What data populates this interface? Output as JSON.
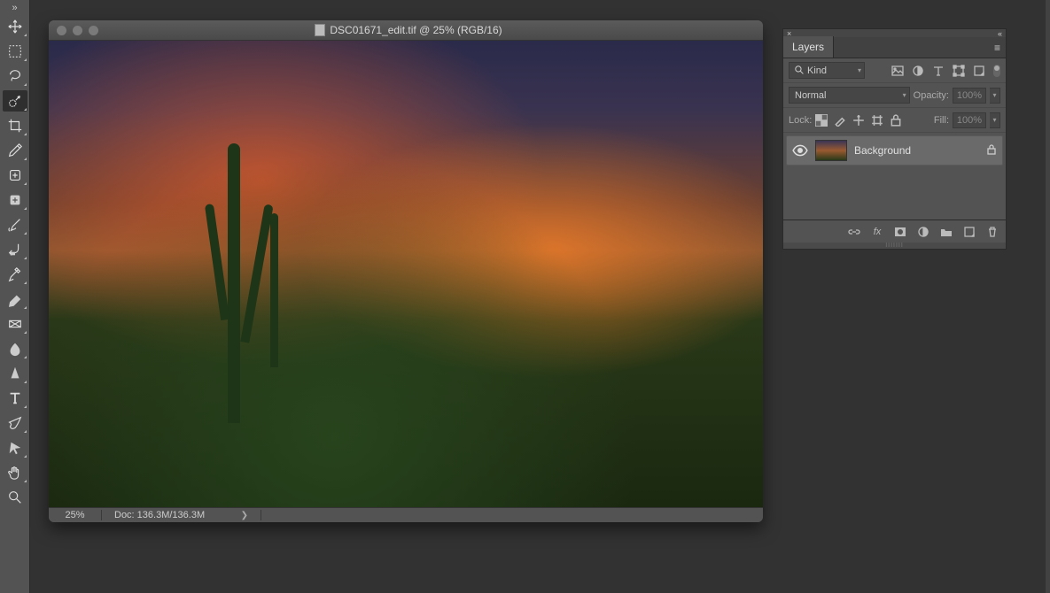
{
  "window": {
    "title": "DSC01671_edit.tif @ 25% (RGB/16)"
  },
  "status": {
    "zoom": "25%",
    "doc": "Doc: 136.3M/136.3M"
  },
  "toolbar": {
    "tools": [
      "move-tool",
      "rectangular-marquee-tool",
      "lasso-tool",
      "quick-selection-tool",
      "crop-tool",
      "eyedropper-tool",
      "spot-healing-brush-tool",
      "brush-tool",
      "clone-stamp-tool",
      "history-brush-tool",
      "eraser-tool",
      "gradient-tool",
      "blur-tool",
      "dodge-tool",
      "pen-tool",
      "type-tool",
      "path-selection-tool",
      "rectangle-tool",
      "hand-tool",
      "zoom-tool"
    ],
    "selected": "quick-selection-tool"
  },
  "layers_panel": {
    "tab": "Layers",
    "filter_label": "Kind",
    "blend_mode": "Normal",
    "opacity_label": "Opacity:",
    "opacity_value": "100%",
    "lock_label": "Lock:",
    "fill_label": "Fill:",
    "fill_value": "100%",
    "items": [
      {
        "name": "Background",
        "locked": true,
        "visible": true
      }
    ]
  }
}
